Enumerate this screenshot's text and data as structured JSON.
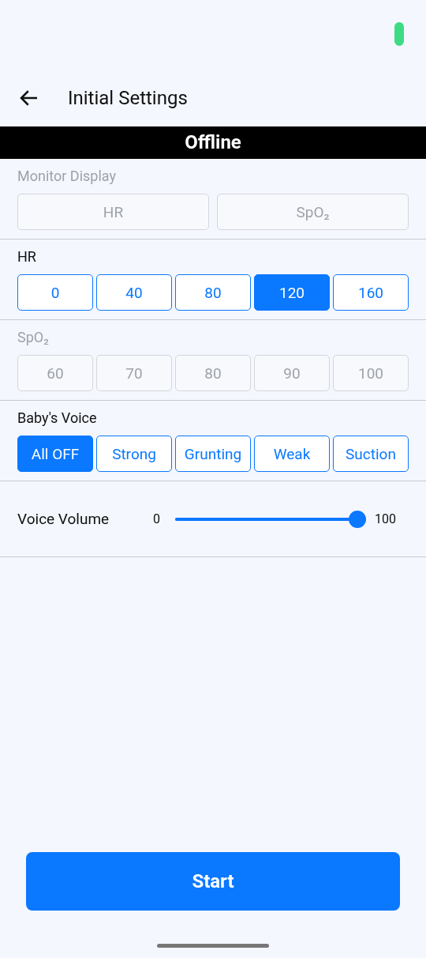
{
  "header": {
    "title": "Initial Settings"
  },
  "banner": {
    "text": "Offline"
  },
  "sections": [
    {
      "kind": "options",
      "label": "Monitor Display",
      "disabled": true,
      "options": [
        {
          "label": "HR",
          "selected": false
        },
        {
          "label": "SpO₂",
          "selected": false
        }
      ]
    },
    {
      "kind": "options",
      "label": "HR",
      "disabled": false,
      "options": [
        {
          "label": "0",
          "selected": false
        },
        {
          "label": "40",
          "selected": false
        },
        {
          "label": "80",
          "selected": false
        },
        {
          "label": "120",
          "selected": true
        },
        {
          "label": "160",
          "selected": false
        }
      ]
    },
    {
      "kind": "options",
      "label": "SpO₂",
      "disabled": true,
      "options": [
        {
          "label": "60",
          "selected": false
        },
        {
          "label": "70",
          "selected": false
        },
        {
          "label": "80",
          "selected": false
        },
        {
          "label": "90",
          "selected": false
        },
        {
          "label": "100",
          "selected": false
        }
      ]
    },
    {
      "kind": "options",
      "label": "Baby's Voice",
      "disabled": false,
      "options": [
        {
          "label": "All OFF",
          "selected": true
        },
        {
          "label": "Strong",
          "selected": false
        },
        {
          "label": "Grunting",
          "selected": false
        },
        {
          "label": "Weak",
          "selected": false
        },
        {
          "label": "Suction",
          "selected": false
        }
      ]
    },
    {
      "kind": "slider",
      "label": "Voice Volume",
      "min_label": "0",
      "max_label": "100",
      "level": 1.0
    }
  ],
  "start_button": {
    "label": "Start"
  }
}
